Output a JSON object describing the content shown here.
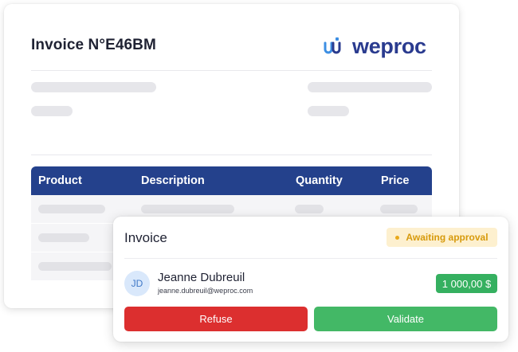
{
  "invoice": {
    "title": "Invoice N°E46BM",
    "brand": "weproc",
    "table": {
      "headers": [
        "Product",
        "Description",
        "Quantity",
        "Price"
      ]
    }
  },
  "popup": {
    "title": "Invoice",
    "status": "Awaiting approval",
    "requester": {
      "initials": "JD",
      "name": "Jeanne Dubreuil",
      "email": "jeanne.dubreuil@weproc.com"
    },
    "amount": "1 000,00 $",
    "refuse_label": "Refuse",
    "validate_label": "Validate"
  },
  "colors": {
    "brand": "#2a3b8f",
    "table_header": "#24418c",
    "status_text": "#d79a0c",
    "status_bg": "#fdf0cf",
    "amount_bg": "#35b060",
    "refuse": "#dc2f2f",
    "validate": "#43b866"
  }
}
